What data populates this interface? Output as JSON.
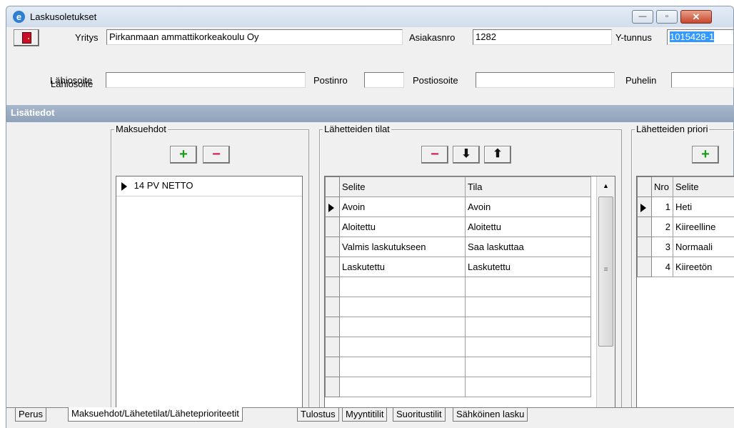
{
  "window": {
    "title": "Laskusoletukset"
  },
  "window_buttons": {
    "minimize": "—",
    "restore": "▫",
    "close": "✕"
  },
  "header": {
    "yritys": {
      "label": "Yritys",
      "value": "Pirkanmaan ammattikorkeakoulu Oy"
    },
    "asiakasnro": {
      "label": "Asiakasnro",
      "value": "1282"
    },
    "ytunnus": {
      "label": "Y-tunnus",
      "value": "1015428-1"
    },
    "lahiosoite": {
      "label": "Lähiosoite",
      "value": ""
    },
    "postinro": {
      "label": "Postinro",
      "value": ""
    },
    "postiosoite": {
      "label": "Postiosoite",
      "value": ""
    },
    "puhelin": {
      "label": "Puhelin",
      "value": ""
    }
  },
  "section": {
    "title": "Lisätiedot"
  },
  "maksuehdot": {
    "title": "Maksuehdot",
    "items": [
      "14 PV NETTO"
    ]
  },
  "lahetetilat": {
    "title": "Lähetteiden tilat",
    "columns": [
      "Selite",
      "Tila"
    ],
    "rows": [
      [
        "Avoin",
        "Avoin"
      ],
      [
        "Aloitettu",
        "Aloitettu"
      ],
      [
        "Valmis laskutukseen",
        "Saa laskuttaa"
      ],
      [
        "Laskutettu",
        "Laskutettu"
      ]
    ]
  },
  "prioriteetit": {
    "title": "Lähetteiden priori",
    "columns": [
      "Nro",
      "Selite"
    ],
    "rows": [
      [
        "1",
        "Heti"
      ],
      [
        "2",
        "Kiireelline"
      ],
      [
        "3",
        "Normaali"
      ],
      [
        "4",
        "Kiireetön"
      ]
    ]
  },
  "tabs": [
    "Perus",
    "Maksuehdot/Lähetetilat/Läheteprioriteetit",
    "Tulostus",
    "Myyntitilit",
    "Suoritustilit",
    "Sähköinen lasku"
  ],
  "active_tab": "Maksuehdot/Lähetetilat/Läheteprioriteetit"
}
